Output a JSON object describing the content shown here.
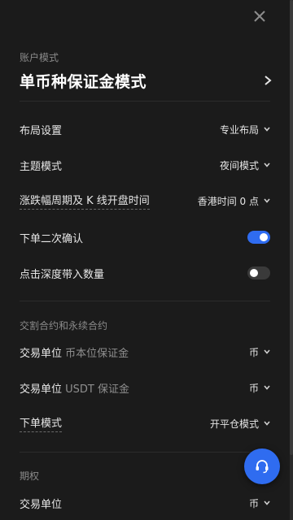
{
  "header": {
    "close_icon": "close-icon"
  },
  "account": {
    "label": "账户模式",
    "value": "单币种保证金模式",
    "icon": "chevron-right-icon"
  },
  "settings": [
    {
      "label": "布局设置",
      "value": "专业布局",
      "type": "select"
    },
    {
      "label": "主题模式",
      "value": "夜间模式",
      "type": "select"
    },
    {
      "label": "涨跌幅周期及 K 线开盘时间",
      "value": "香港时间 0 点",
      "type": "select"
    },
    {
      "label": "下单二次确认",
      "type": "toggle",
      "on": true
    },
    {
      "label": "点击深度带入数量",
      "type": "toggle",
      "on": false
    }
  ],
  "futures": {
    "title": "交割合约和永续合约",
    "rows": [
      {
        "label": "交易单位",
        "sub": "币本位保证金",
        "value": "币"
      },
      {
        "label": "交易单位",
        "sub": "USDT 保证金",
        "value": "币"
      },
      {
        "label": "下单模式",
        "value": "开平仓模式"
      }
    ]
  },
  "options": {
    "title": "期权",
    "rows": [
      {
        "label": "交易单位",
        "value": "币"
      }
    ]
  },
  "support_button": {
    "icon": "headset-icon"
  },
  "colors": {
    "background": "#1b1b1b",
    "accent": "#2f6cf0",
    "muted_text": "#8a8a8a"
  }
}
